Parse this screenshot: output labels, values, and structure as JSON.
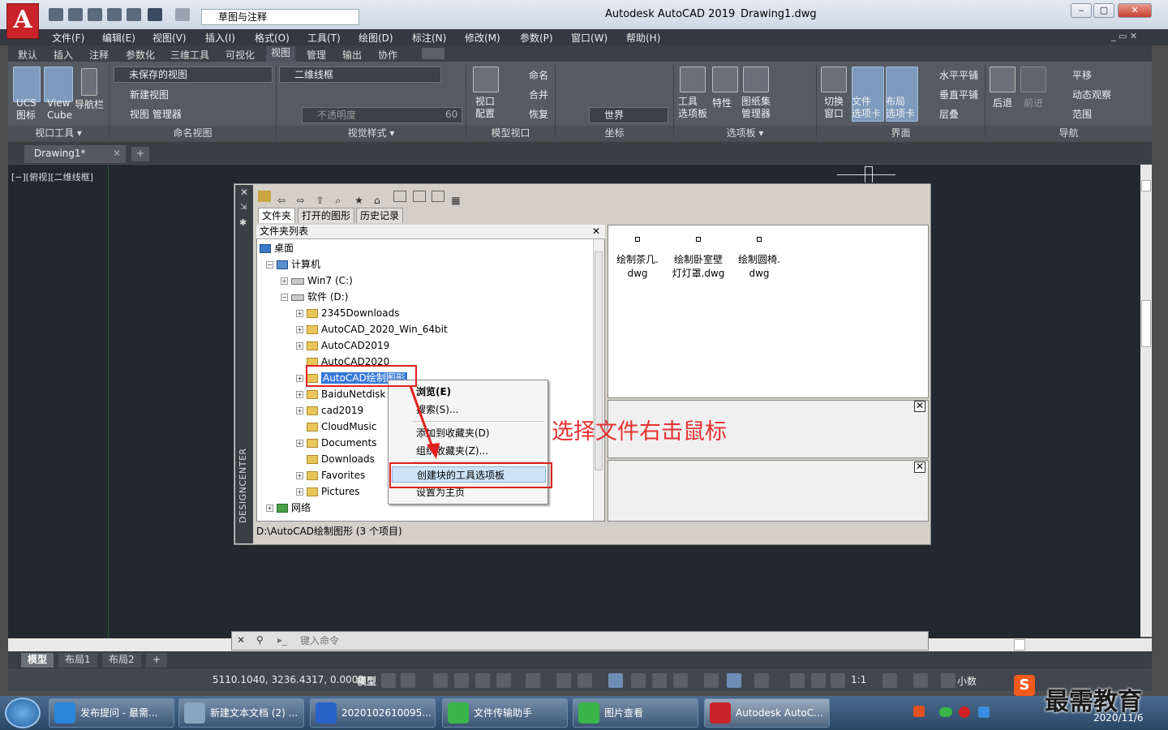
{
  "app": {
    "title": "Autodesk AutoCAD 2019",
    "file": "Drawing1.dwg",
    "workspace": "草图与注释"
  },
  "menu": [
    "文件(F)",
    "编辑(E)",
    "视图(V)",
    "插入(I)",
    "格式(O)",
    "工具(T)",
    "绘图(D)",
    "标注(N)",
    "修改(M)",
    "参数(P)",
    "窗口(W)",
    "帮助(H)"
  ],
  "ribbon_tabs": [
    "默认",
    "插入",
    "注释",
    "参数化",
    "三维工具",
    "可视化",
    "视图",
    "管理",
    "输出",
    "协作"
  ],
  "ribbon": {
    "ucs": "UCS\n图标",
    "viewcube": "View\nCube",
    "navbar": "导航栏",
    "saved_view": "未保存的视图",
    "new_view": "新建视图",
    "view_manager": "视图 管理器",
    "visual_style": "二维线框",
    "opacity": "不透明度",
    "opacity_val": "60",
    "viewport_config": "视口\n配置",
    "name": "命名",
    "join": "合并",
    "restore": "恢复",
    "world": "世界",
    "tool_palette": "工具\n选项板",
    "properties": "特性",
    "sheetset": "图纸集\n管理器",
    "switch_window": "切换\n窗口",
    "file_tabs": "文件\n选项卡",
    "layout_tabs": "布局\n选项卡",
    "tile_h": "水平平铺",
    "tile_v": "垂直平铺",
    "cascade": "层叠",
    "back": "后退",
    "forward": "前进",
    "pan": "平移",
    "orbit": "动态观察",
    "extents": "范围",
    "panels": [
      "视口工具 ▾",
      "命名视图",
      "视觉样式 ▾",
      "模型视口",
      "坐标",
      "选项板 ▾",
      "界面",
      "导航"
    ]
  },
  "doc_tab": "Drawing1*",
  "view_label": "[−][俯视][二维线框]",
  "design_center": {
    "side_title": "DESIGNCENTER",
    "tabs": [
      "文件夹",
      "打开的图形",
      "历史记录"
    ],
    "tree_header": "文件夹列表",
    "tree": [
      {
        "label": "桌面",
        "lvl": 0,
        "type": "desktop"
      },
      {
        "label": "计算机",
        "lvl": 1,
        "type": "computer",
        "pm": "−"
      },
      {
        "label": "Win7 (C:)",
        "lvl": 2,
        "type": "drive",
        "pm": "+"
      },
      {
        "label": "软件 (D:)",
        "lvl": 2,
        "type": "drive",
        "pm": "−"
      },
      {
        "label": "2345Downloads",
        "lvl": 3,
        "type": "folder",
        "pm": "+"
      },
      {
        "label": "AutoCAD_2020_Win_64bit",
        "lvl": 3,
        "type": "folder",
        "pm": "+"
      },
      {
        "label": "AutoCAD2019",
        "lvl": 3,
        "type": "folder",
        "pm": "+"
      },
      {
        "label": "AutoCAD2020",
        "lvl": 3,
        "type": "folder",
        "pm": ""
      },
      {
        "label": "AutoCAD绘制图形",
        "lvl": 3,
        "type": "folder",
        "pm": "+",
        "selected": true
      },
      {
        "label": "BaiduNetdisk",
        "lvl": 3,
        "type": "folder",
        "pm": "+"
      },
      {
        "label": "cad2019",
        "lvl": 3,
        "type": "folder",
        "pm": "+"
      },
      {
        "label": "CloudMusic",
        "lvl": 3,
        "type": "folder",
        "pm": ""
      },
      {
        "label": "Documents",
        "lvl": 3,
        "type": "folder",
        "pm": "+"
      },
      {
        "label": "Downloads",
        "lvl": 3,
        "type": "folder",
        "pm": ""
      },
      {
        "label": "Favorites",
        "lvl": 3,
        "type": "folder",
        "pm": "+"
      },
      {
        "label": "Pictures",
        "lvl": 3,
        "type": "folder",
        "pm": "+"
      },
      {
        "label": "网络",
        "lvl": 1,
        "type": "network",
        "pm": "+"
      }
    ],
    "files": [
      {
        "name": "绘制茶几.\ndwg"
      },
      {
        "name": "绘制卧室壁\n灯灯罩.dwg"
      },
      {
        "name": "绘制圆椅.\ndwg"
      }
    ],
    "status": "D:\\AutoCAD绘制图形 (3 个项目)"
  },
  "context_menu": {
    "browse": "浏览(E)",
    "search": "搜索(S)...",
    "add_fav": "添加到收藏夹(D)",
    "organize_fav": "组织收藏夹(Z)...",
    "create_palette": "创建块的工具选项板",
    "set_home": "设置为主页"
  },
  "annotation": "选择文件右击鼠标",
  "command": {
    "placeholder": "键入命令"
  },
  "layout_tabs": [
    "模型",
    "布局1",
    "布局2"
  ],
  "status_bar": {
    "coords": "5110.1040, 3236.4317, 0.0000",
    "model": "模型",
    "scale": "1:1",
    "units": "小数"
  },
  "taskbar": {
    "items": [
      "发布提问 - 最需...",
      "新建文本文档 (2) ...",
      "2020102610095...",
      "文件传输助手",
      "图片查看",
      "Autodesk AutoC..."
    ],
    "date": "2020/11/6"
  },
  "watermark": "最需教育",
  "colors": {
    "annotation": "#e83030",
    "accent": "#7e9bbd"
  }
}
